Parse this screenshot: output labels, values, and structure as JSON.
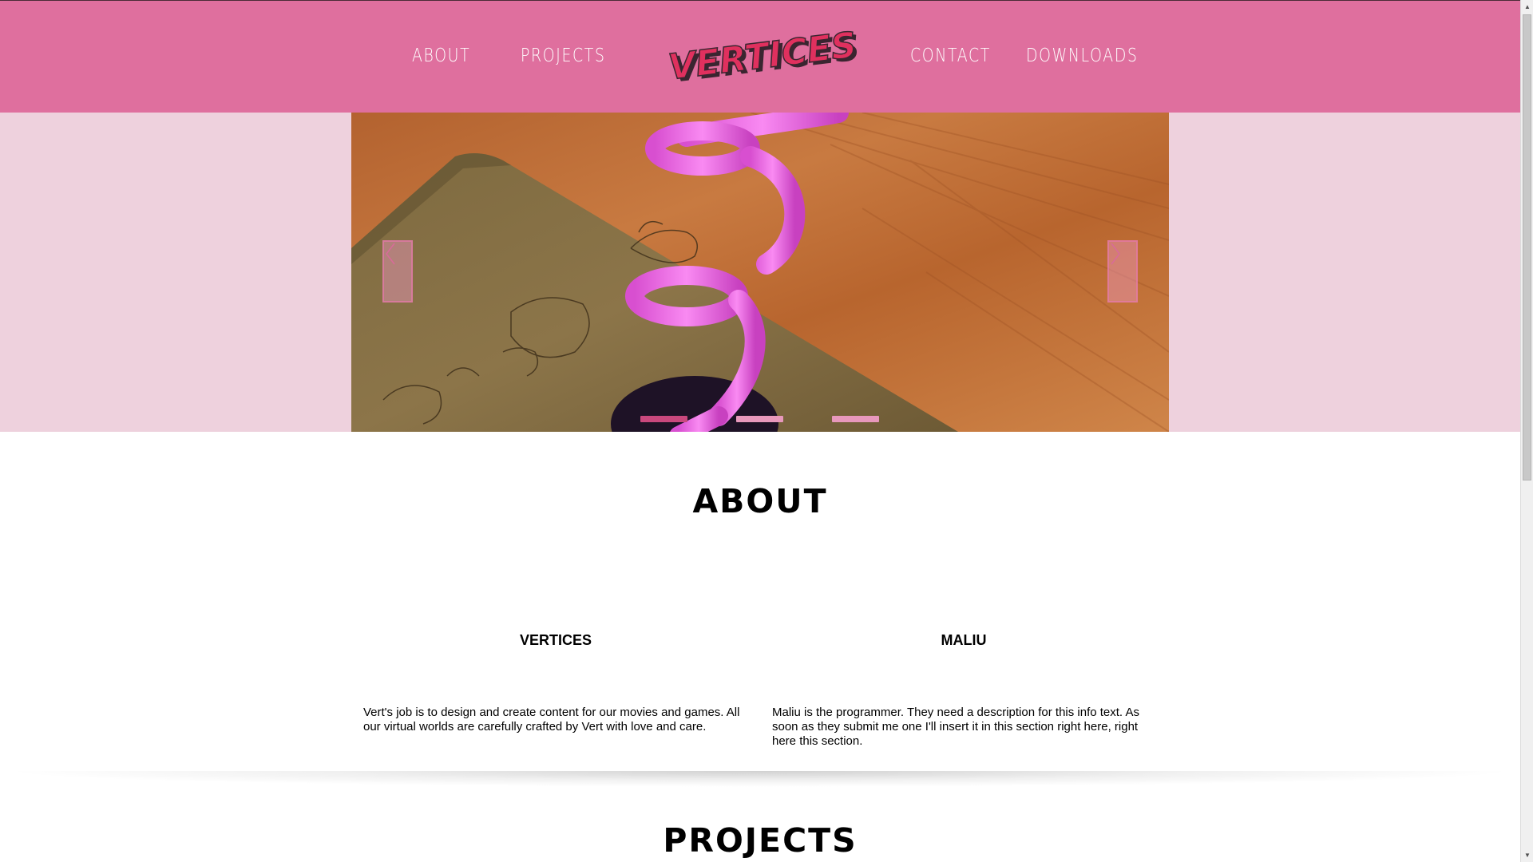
{
  "nav": {
    "about": "ABOUT",
    "projects": "PROJECTS",
    "contact": "CONTACT",
    "downloads": "DOWNLOADS",
    "logo_text": "VERTICES"
  },
  "carousel": {
    "slide_count": 3,
    "active_slide": 1,
    "prev_icon": "chevron-left-icon",
    "next_icon": "chevron-right-icon"
  },
  "about": {
    "title": "ABOUT",
    "columns": [
      {
        "heading": "VERTICES",
        "text": "Vert's job is to design and create content for our movies and games. All our virtual worlds are carefully crafted by Vert with love and care."
      },
      {
        "heading": "MALIU",
        "text": "Maliu is the programmer. They need a description for this info text. As soon as they submit me one I'll insert it in this section right here, right here this section."
      }
    ]
  },
  "projects": {
    "title": "PROJECTS"
  },
  "colors": {
    "header": "#df6f9e",
    "band": "#eed1dd",
    "dot_active": "#c9487d",
    "dot_inactive": "#e898bc",
    "spiral": "#f06ee6"
  }
}
